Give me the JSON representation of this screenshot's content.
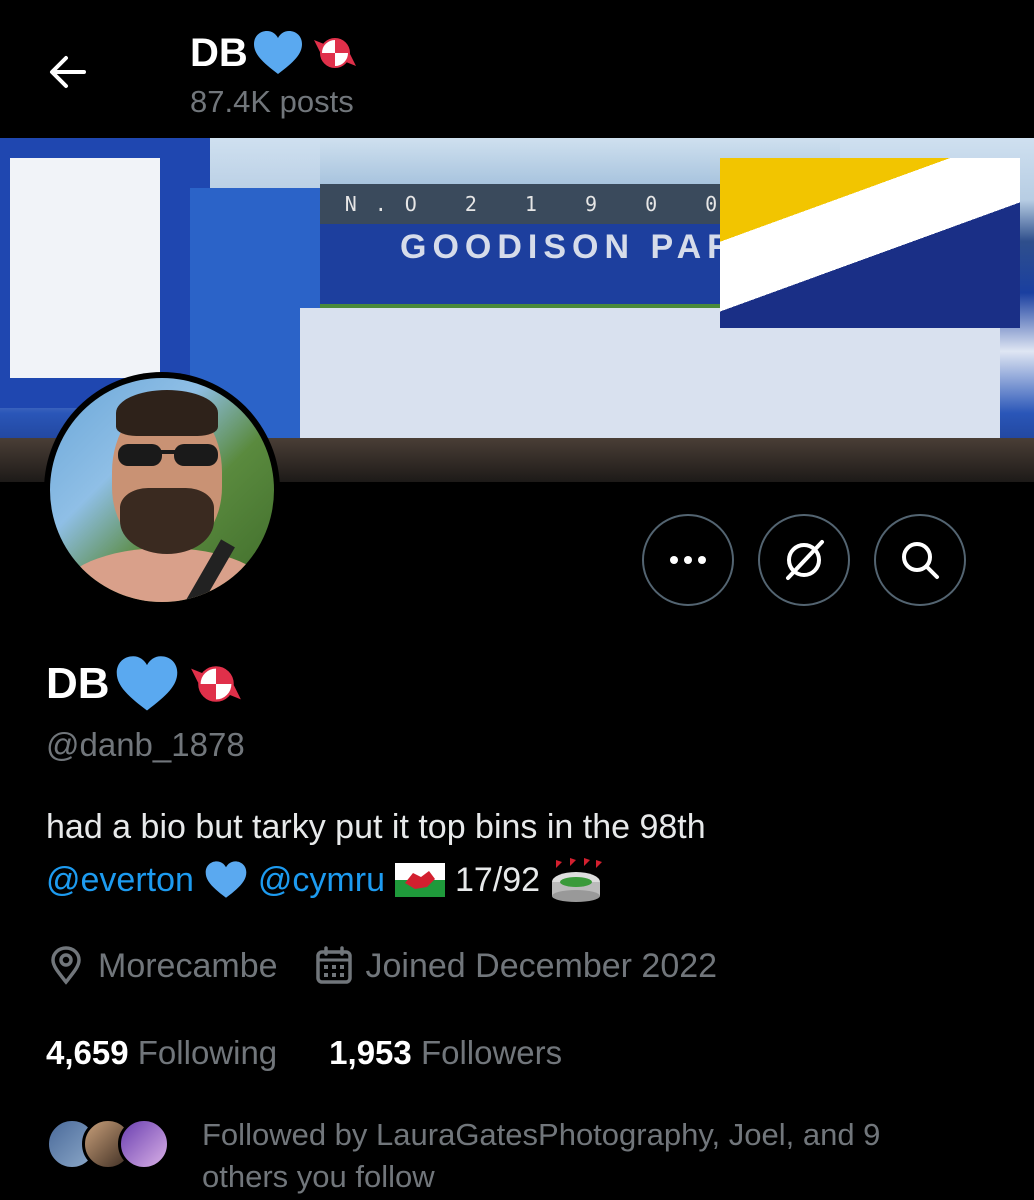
{
  "header": {
    "title": "DB",
    "posts_count": "87.4K posts"
  },
  "banner": {
    "stand_text": "N.O 2 1 9 0 0 9",
    "crowd_text": "GOODISON PARK"
  },
  "profile": {
    "name": "DB",
    "handle": "@danb_1878",
    "bio_line1": "had a bio but tarky put it top bins in the 98th",
    "bio_mention1": "@everton",
    "bio_mention2": "@cymru",
    "bio_suffix": "17/92",
    "location": "Morecambe",
    "joined": "Joined December 2022",
    "following_count": "4,659",
    "following_label": "Following",
    "followers_count": "1,953",
    "followers_label": "Followers",
    "followed_by_line1": "Followed by LauraGatesPhotography, Joel, and 9",
    "followed_by_line2": "others you follow"
  },
  "icons": {
    "back": "arrow-left-icon",
    "more": "more-dots-icon",
    "grok": "grok-icon",
    "search": "search-icon",
    "location": "location-pin-icon",
    "calendar": "calendar-icon",
    "heart": "blue-heart-emoji",
    "candy": "candy-emoji",
    "flag": "wales-flag-emoji",
    "stadium": "stadium-emoji"
  },
  "colors": {
    "background": "#000000",
    "text_primary": "#e7e9ea",
    "text_secondary": "#71767b",
    "link": "#1d9bf0",
    "heart": "#5aa9f0",
    "button_border": "#536471"
  }
}
